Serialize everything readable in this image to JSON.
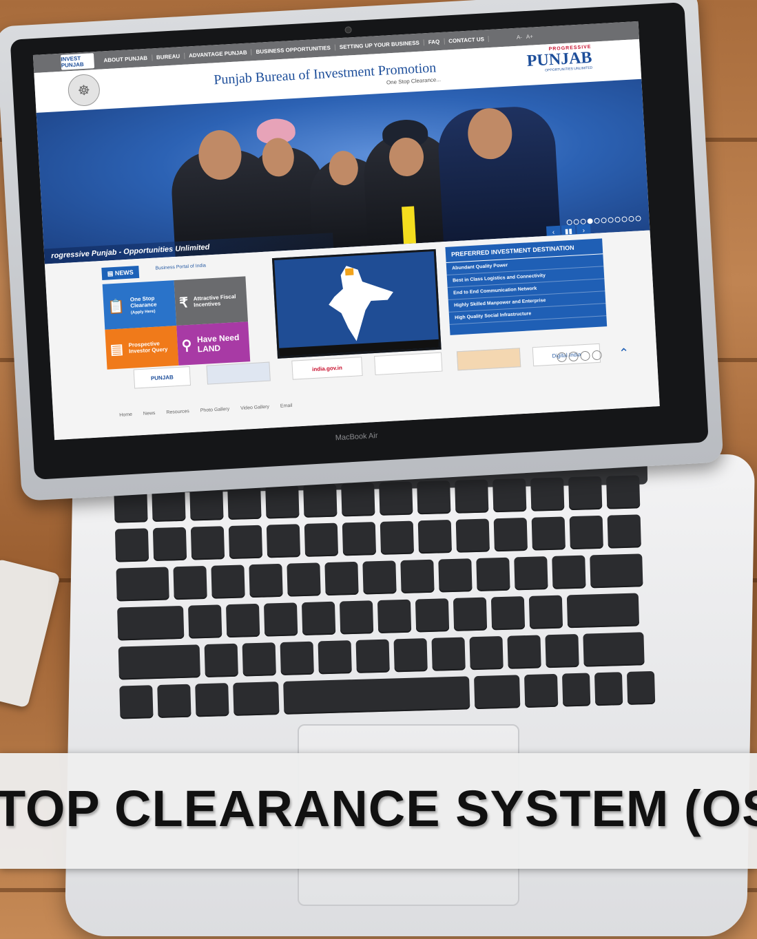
{
  "website": {
    "nav": {
      "logo_text": "INVEST PUNJAB",
      "items": [
        "ABOUT PUNJAB",
        "BUREAU",
        "ADVANTAGE PUNJAB",
        "BUSINESS OPPORTUNITIES",
        "SETTING UP YOUR BUSINESS",
        "FAQ",
        "CONTACT US"
      ],
      "font_small": "A-",
      "font_large": "A+"
    },
    "header": {
      "title": "Punjab Bureau of Investment Promotion",
      "tagline": "One Stop Clearance...",
      "brand_small": "PROGRESSIVE",
      "brand_big": "PUNJAB",
      "brand_sub": "OPPORTUNITIES UNLIMITED"
    },
    "hero": {
      "caption": "rogressive Punjab - Opportunities Unlimited"
    },
    "news": {
      "tab_label": "NEWS",
      "portal_link": "Business Portal of India"
    },
    "tiles": {
      "one_stop": "One Stop Clearance",
      "one_stop_sub": "(Apply Here)",
      "fiscal": "Attractive Fiscal Incentives",
      "investor": "Prospective Investor Query",
      "land": "Have Need LAND"
    },
    "preferred": {
      "title": "PREFERRED INVESTMENT DESTINATION",
      "items": [
        "Abundant Quality Power",
        "Best in Class Logistics and Connectivity",
        "End to End Communication Network",
        "Highly Skilled Manpower and Enterprise",
        "High Quality Social Infrastructure"
      ]
    },
    "partners": {
      "punjab": "PUNJAB",
      "india_gov": "india.gov.in",
      "digital_india": "Digital India"
    },
    "footer_nav": [
      "Home",
      "News",
      "Resources",
      "Photo Gallery",
      "Video Gallery",
      "Email"
    ]
  },
  "laptop": {
    "brand": "MacBook Air"
  },
  "banner": {
    "title": "TOP CLEARANCE SYSTEM (OS"
  }
}
